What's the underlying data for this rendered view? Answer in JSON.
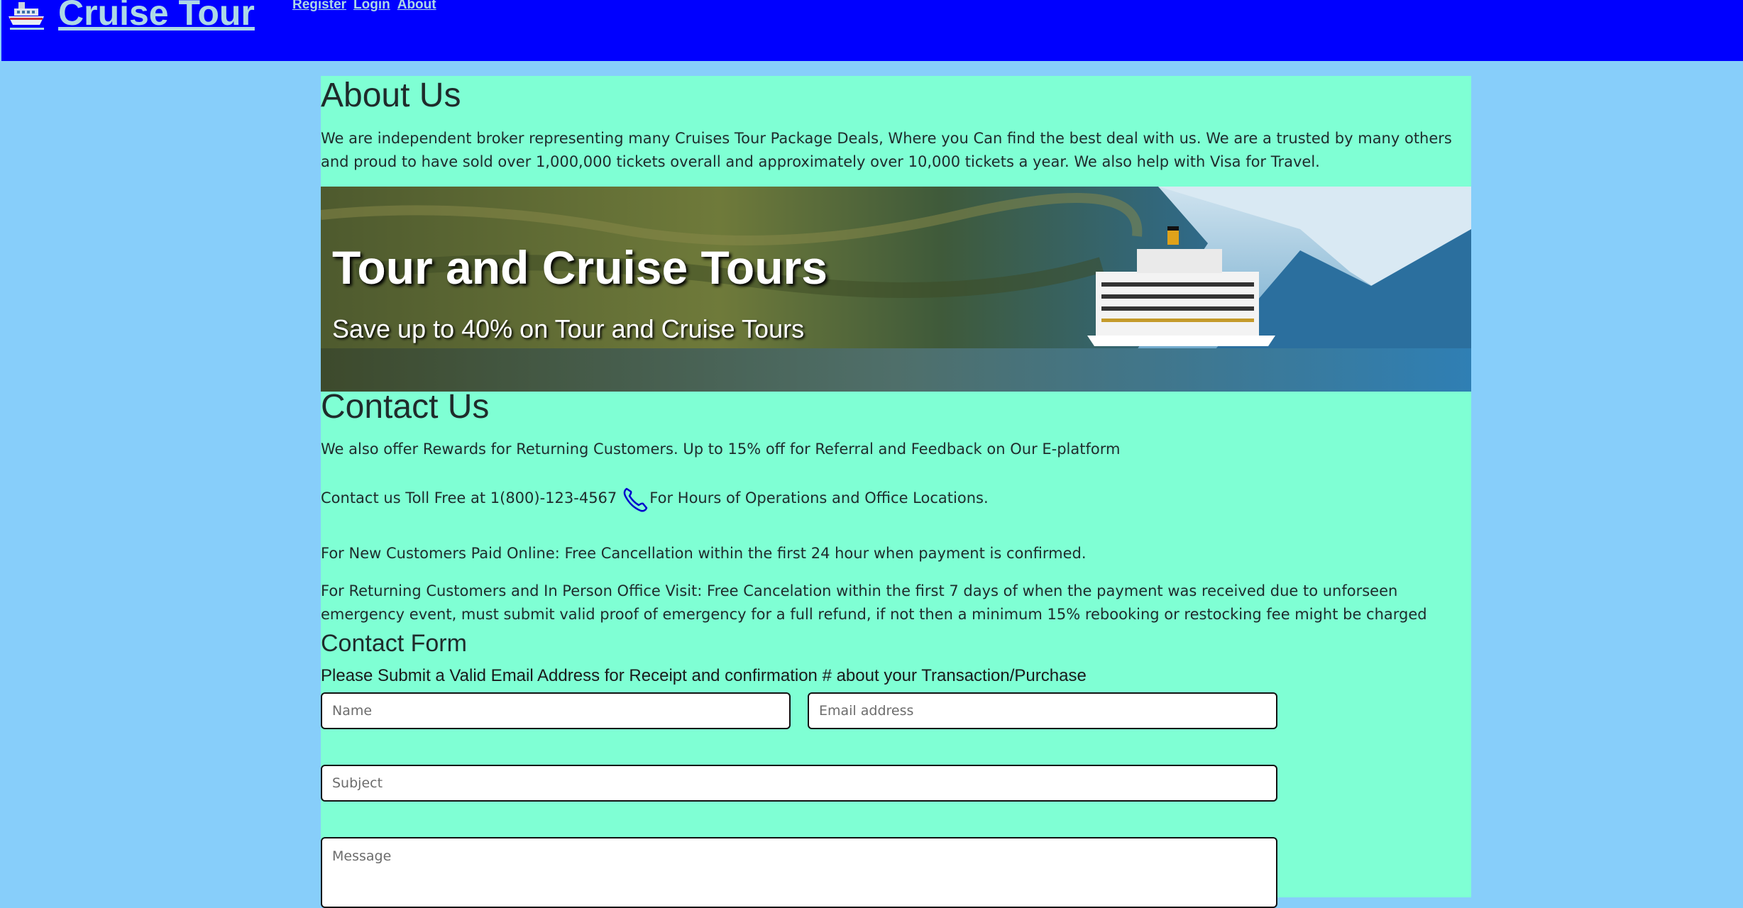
{
  "header": {
    "brand": "Cruise Tour",
    "brand_icon": "cruise-ship-icon",
    "nav": [
      "Register",
      "Login",
      "About"
    ],
    "colors": {
      "bar": "#0000ff",
      "link": "#add8e6",
      "page_bg": "#87cefa",
      "content_bg": "#7fffd4"
    }
  },
  "about": {
    "title": "About Us",
    "text": "We are independent broker representing many Cruises Tour Package Deals, Where you Can find the best deal with us. We are a trusted by many others and proud to have sold over 1,000,000 tickets overall and approximately over 10,000 tickets a year. We also help with Visa for Travel."
  },
  "banner": {
    "title": "Tour and Cruise Tours",
    "subtitle": "Save up to 40% on Tour and Cruise Tours"
  },
  "contact": {
    "title": "Contact Us",
    "rewards": "We also offer Rewards for Returning Customers. Up to 15% off for Referral and Feedback on Our E-platform",
    "phone_prefix": "Contact us Toll Free at 1(800)-123-4567",
    "phone_icon": "phone-icon",
    "phone_suffix": "For Hours of Operations and Office Locations.",
    "new_customers": "For New Customers Paid Online: Free Cancellation within the first 24 hour when payment is confirmed.",
    "returning": "For Returning Customers and In Person Office Visit: Free Cancelation within the first 7 days of when the payment was received due to unforseen emergency event, must submit valid proof of emergency for a full refund, if not then a minimum 15% rebooking or restocking fee might be charged"
  },
  "form": {
    "title": "Contact Form",
    "intro": "Please Submit a Valid Email Address for Receipt and confirmation # about your Transaction/Purchase",
    "name_placeholder": "Name",
    "email_placeholder": "Email address",
    "subject_placeholder": "Subject",
    "message_placeholder": "Message"
  }
}
